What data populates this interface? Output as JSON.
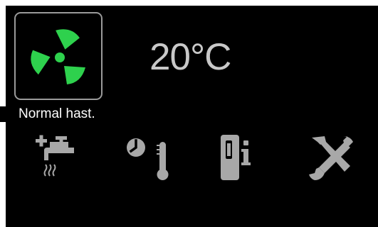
{
  "status": {
    "fan_mode_label": "Normal hast.",
    "temperature": "20°C"
  },
  "colors": {
    "background": "#000000",
    "fan_accent": "#2ed14d",
    "icon_gray": "#a8a8a8",
    "temperature_text": "#c8c8c8",
    "label_text": "#ffffff",
    "box_border": "#9a9a9a"
  },
  "toolbar": {
    "items": [
      {
        "icon": "hot-water-tap-icon"
      },
      {
        "icon": "clock-thermometer-icon"
      },
      {
        "icon": "device-info-icon"
      },
      {
        "icon": "tools-icon"
      }
    ]
  }
}
